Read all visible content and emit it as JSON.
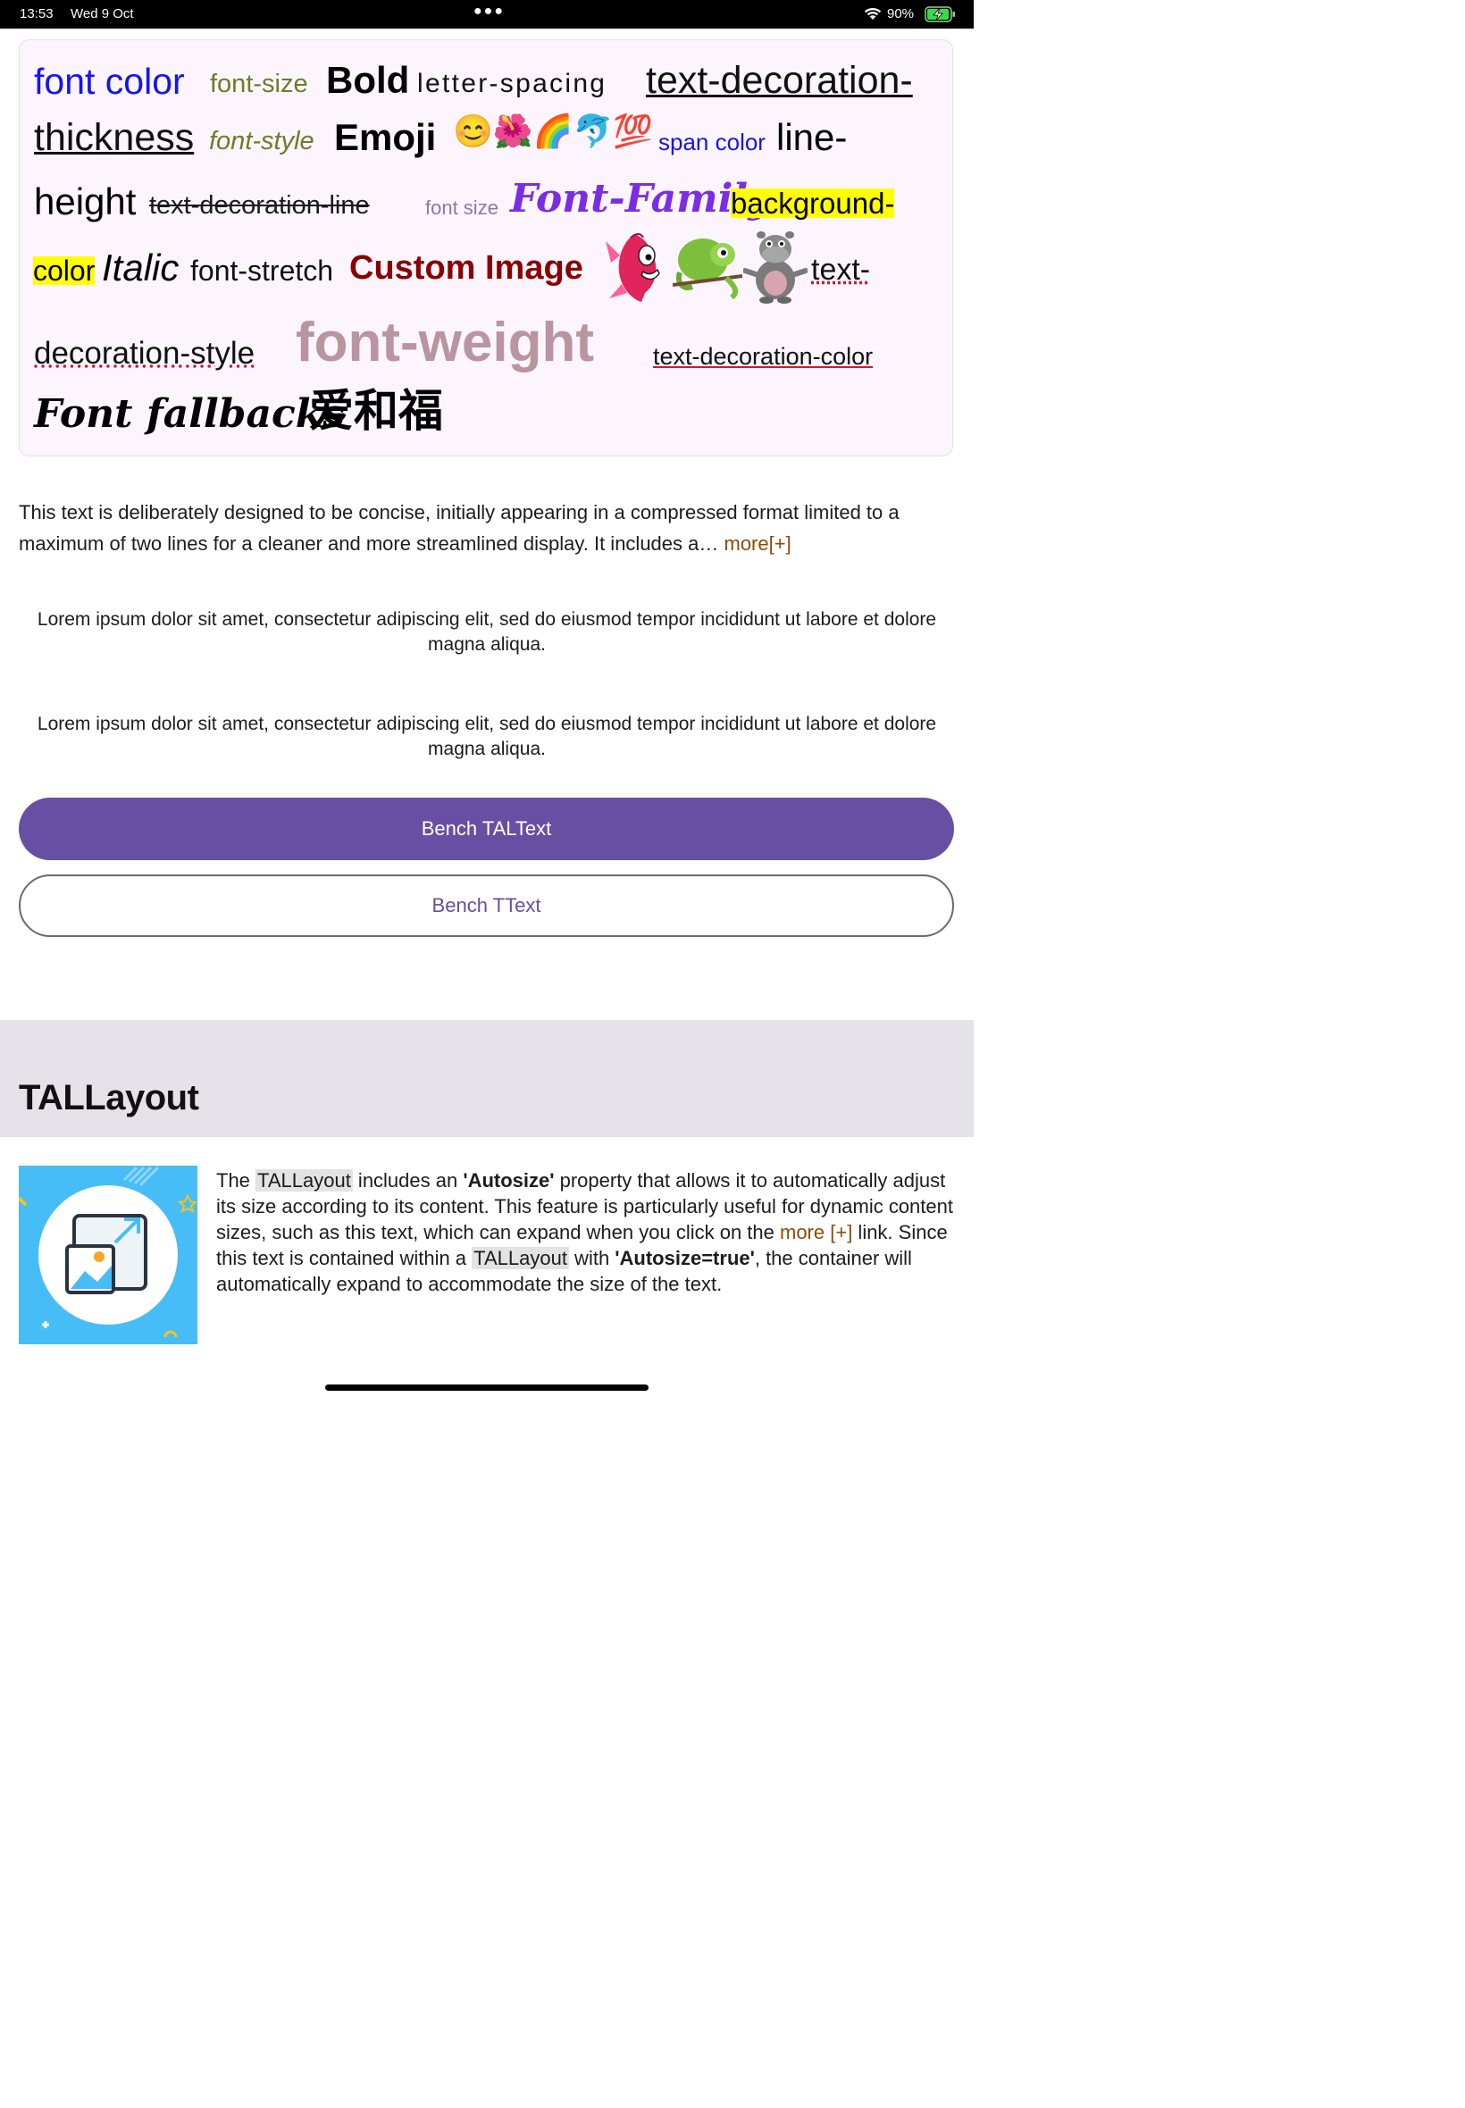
{
  "status_bar": {
    "time": "13:53",
    "date": "Wed 9 Oct",
    "battery": "90%"
  },
  "rich_text": {
    "font_color": "font color",
    "font_size": "font-size",
    "bold": "Bold",
    "letter_spacing": "letter-spacing",
    "text_decoration_1": "text-decoration-",
    "text_decoration_2": "thickness",
    "font_style": "font-style",
    "emoji_label": "Emoji",
    "emojis": "😊🌺🌈🐬💯",
    "span_color": "span color",
    "line_1": "line-",
    "line_2": "height",
    "strike": "text-decoration-line",
    "font_size_small": "font size",
    "font_family": "Font-Family",
    "bg_1": "background-",
    "bg_2": "color",
    "italic": "Italic",
    "font_stretch": "font-stretch",
    "custom_image": "Custom Image",
    "tds_1": "text-",
    "tds_2": "decoration-style",
    "font_weight": "font-weight",
    "td_color": "text-decoration-color",
    "fallbacks": "Font fallbacks",
    "cjk": "爱和福"
  },
  "expandable": {
    "text": "This text is deliberately designed to be concise, initially appearing in a compressed format limited to a maximum of two lines for a cleaner and more streamlined display. It includes a…",
    "more_link": "more[+]"
  },
  "lorem_1": "Lorem ipsum dolor sit amet, consectetur adipiscing elit, sed do eiusmod tempor incididunt ut labore et dolore magna aliqua.",
  "lorem_2": "Lorem ipsum dolor sit amet, consectetur adipiscing elit, sed do eiusmod tempor incididunt ut labore et dolore magna aliqua.",
  "buttons": {
    "bench_tal": "Bench TALText",
    "bench_t": "Bench TText"
  },
  "section": {
    "title": "TALLayout",
    "p_the": "The ",
    "p_tal1": "TALLayout",
    "p_includes": " includes an ",
    "p_autosize": "'Autosize'",
    "p_mid": " property that allows it to automatically adjust its size according to its content. This feature is particularly useful for dynamic content sizes, such as this text, which can expand when you click on the ",
    "p_more": "more [+]",
    "p_link": " link. Since this text is contained within a ",
    "p_tal2": "TALLayout",
    "p_with": " with ",
    "p_autosize_true": "'Autosize=true'",
    "p_end": ", the container will automatically expand to accommodate the size of the text."
  },
  "icons": [
    "wifi-icon",
    "battery-charging-icon",
    "fish-sticker",
    "chameleon-sticker",
    "hippo-sticker",
    "image-resize-icon"
  ],
  "colors": {
    "accent": "#684fa3",
    "link_brown": "#8a4a0b",
    "card_bg": "#fcf5fd",
    "highlight_yellow": "#ffff00"
  }
}
